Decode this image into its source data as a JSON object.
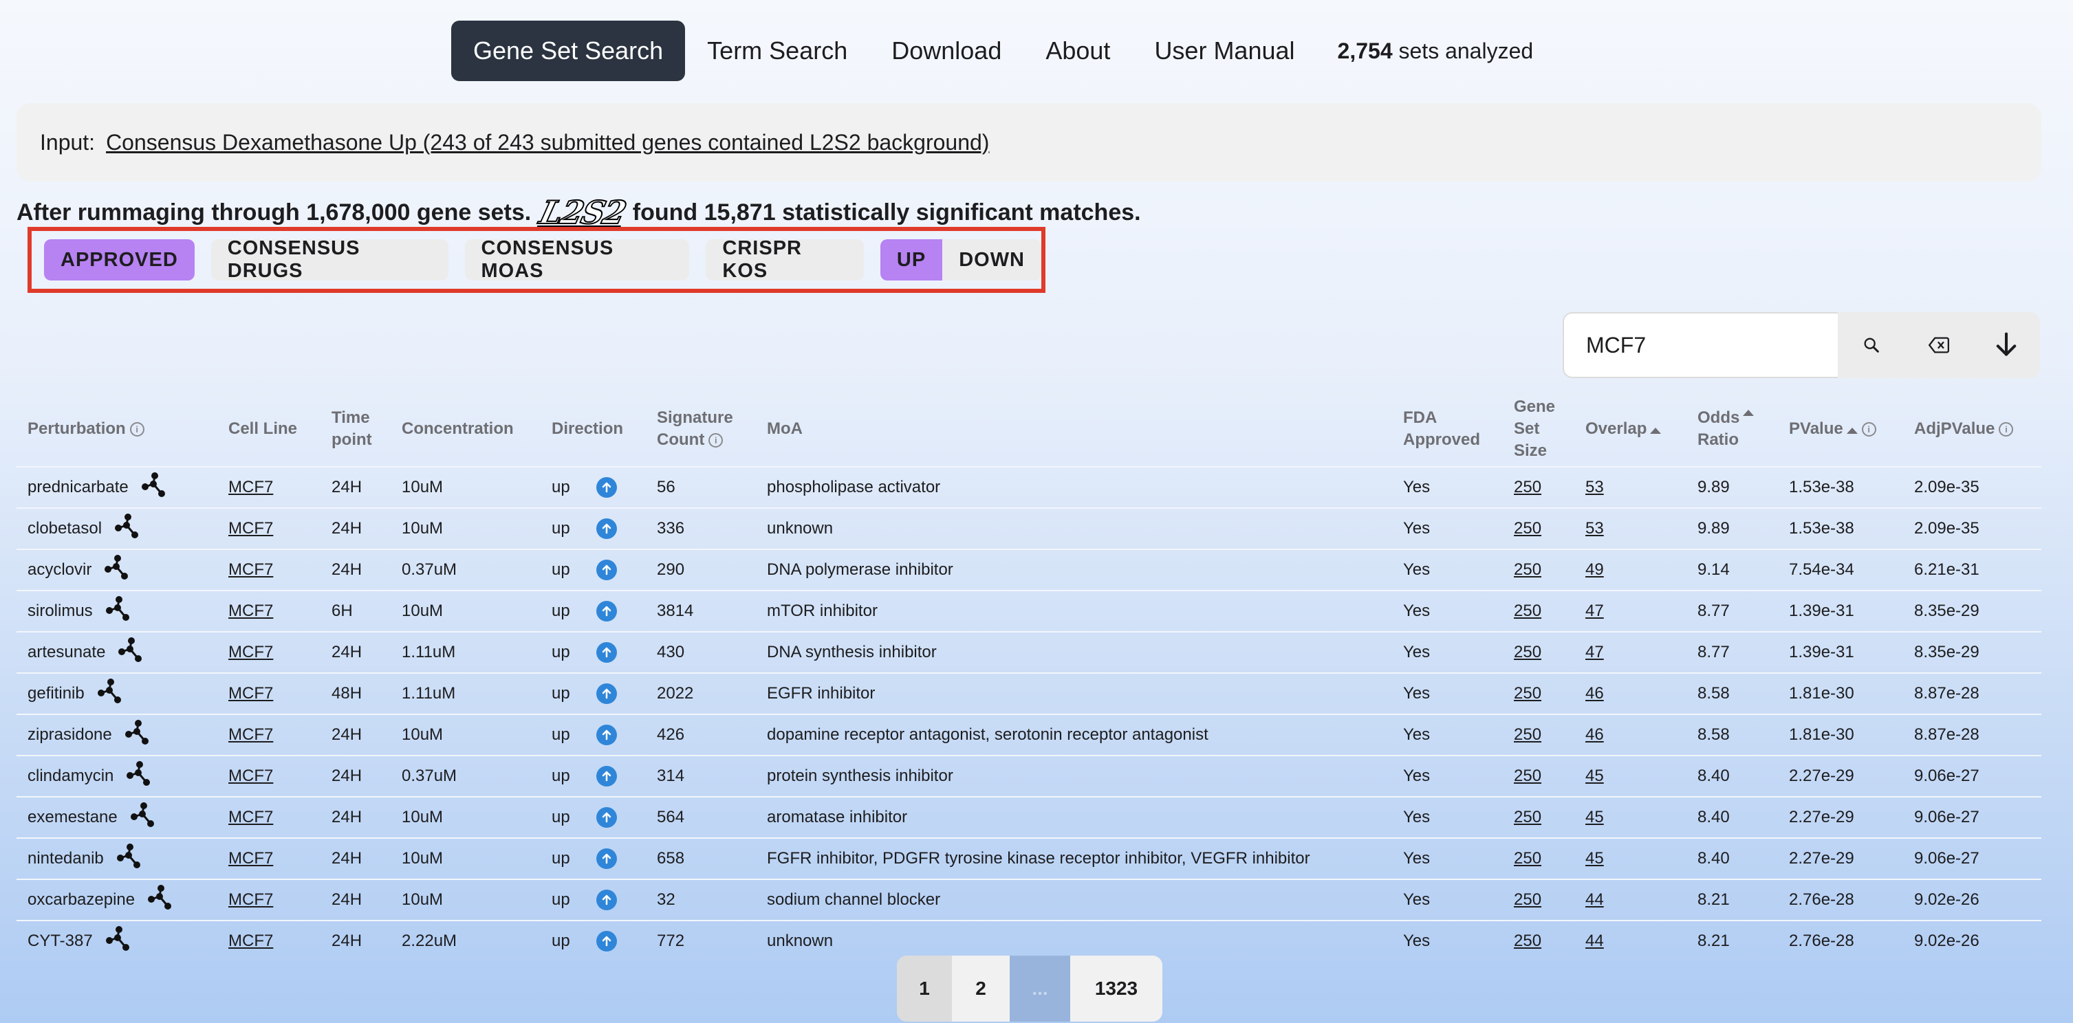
{
  "nav": {
    "items": [
      "Gene Set Search",
      "Term Search",
      "Download",
      "About",
      "User Manual"
    ],
    "stat_count": "2,754",
    "stat_text": "sets analyzed"
  },
  "input": {
    "label": "Input:",
    "link": "Consensus Dexamethasone Up (243 of 243 submitted genes contained L2S2 background)"
  },
  "summary": {
    "before": "After rummaging through 1,678,000 gene sets.",
    "logo": "L2S2",
    "after": "found 15,871 statistically significant matches."
  },
  "filters": {
    "approved": "APPROVED",
    "consensus_drugs": "CONSENSUS DRUGS",
    "consensus_moas": "CONSENSUS MOAS",
    "crispr_kos": "CRISPR KOS",
    "up": "UP",
    "down": "DOWN",
    "active_color": "#b782f2"
  },
  "search": {
    "value": "MCF7",
    "icons": [
      "search-icon",
      "clear-icon",
      "download-icon"
    ]
  },
  "table": {
    "headers": {
      "perturbation": "Perturbation",
      "cell_line": "Cell Line",
      "time_point": [
        "Time",
        "point"
      ],
      "concentration": "Concentration",
      "direction": "Direction",
      "signature_count": [
        "Signature",
        "Count"
      ],
      "moa": "MoA",
      "fda": [
        "FDA",
        "Approved"
      ],
      "gene_set_size": [
        "Gene",
        "Set",
        "Size"
      ],
      "overlap": "Overlap",
      "odds_ratio": [
        "Odds",
        "Ratio"
      ],
      "pvalue": "PValue",
      "adjpvalue": "AdjPValue"
    },
    "rows": [
      {
        "pert": "prednicarbate",
        "cell": "MCF7",
        "time": "24H",
        "conc": "10uM",
        "dir": "up",
        "sig": "56",
        "moa": "phospholipase activator",
        "fda": "Yes",
        "size": "250",
        "overlap": "53",
        "odds": "9.89",
        "p": "1.53e-38",
        "adjp": "2.09e-35"
      },
      {
        "pert": "clobetasol",
        "cell": "MCF7",
        "time": "24H",
        "conc": "10uM",
        "dir": "up",
        "sig": "336",
        "moa": "unknown",
        "fda": "Yes",
        "size": "250",
        "overlap": "53",
        "odds": "9.89",
        "p": "1.53e-38",
        "adjp": "2.09e-35"
      },
      {
        "pert": "acyclovir",
        "cell": "MCF7",
        "time": "24H",
        "conc": "0.37uM",
        "dir": "up",
        "sig": "290",
        "moa": "DNA polymerase inhibitor",
        "fda": "Yes",
        "size": "250",
        "overlap": "49",
        "odds": "9.14",
        "p": "7.54e-34",
        "adjp": "6.21e-31"
      },
      {
        "pert": "sirolimus",
        "cell": "MCF7",
        "time": "6H",
        "conc": "10uM",
        "dir": "up",
        "sig": "3814",
        "moa": "mTOR inhibitor",
        "fda": "Yes",
        "size": "250",
        "overlap": "47",
        "odds": "8.77",
        "p": "1.39e-31",
        "adjp": "8.35e-29"
      },
      {
        "pert": "artesunate",
        "cell": "MCF7",
        "time": "24H",
        "conc": "1.11uM",
        "dir": "up",
        "sig": "430",
        "moa": "DNA synthesis inhibitor",
        "fda": "Yes",
        "size": "250",
        "overlap": "47",
        "odds": "8.77",
        "p": "1.39e-31",
        "adjp": "8.35e-29"
      },
      {
        "pert": "gefitinib",
        "cell": "MCF7",
        "time": "48H",
        "conc": "1.11uM",
        "dir": "up",
        "sig": "2022",
        "moa": "EGFR inhibitor",
        "fda": "Yes",
        "size": "250",
        "overlap": "46",
        "odds": "8.58",
        "p": "1.81e-30",
        "adjp": "8.87e-28"
      },
      {
        "pert": "ziprasidone",
        "cell": "MCF7",
        "time": "24H",
        "conc": "10uM",
        "dir": "up",
        "sig": "426",
        "moa": "dopamine receptor antagonist, serotonin receptor antagonist",
        "fda": "Yes",
        "size": "250",
        "overlap": "46",
        "odds": "8.58",
        "p": "1.81e-30",
        "adjp": "8.87e-28"
      },
      {
        "pert": "clindamycin",
        "cell": "MCF7",
        "time": "24H",
        "conc": "0.37uM",
        "dir": "up",
        "sig": "314",
        "moa": "protein synthesis inhibitor",
        "fda": "Yes",
        "size": "250",
        "overlap": "45",
        "odds": "8.40",
        "p": "2.27e-29",
        "adjp": "9.06e-27"
      },
      {
        "pert": "exemestane",
        "cell": "MCF7",
        "time": "24H",
        "conc": "10uM",
        "dir": "up",
        "sig": "564",
        "moa": "aromatase inhibitor",
        "fda": "Yes",
        "size": "250",
        "overlap": "45",
        "odds": "8.40",
        "p": "2.27e-29",
        "adjp": "9.06e-27"
      },
      {
        "pert": "nintedanib",
        "cell": "MCF7",
        "time": "24H",
        "conc": "10uM",
        "dir": "up",
        "sig": "658",
        "moa": "FGFR inhibitor, PDGFR tyrosine kinase receptor inhibitor, VEGFR inhibitor",
        "fda": "Yes",
        "size": "250",
        "overlap": "45",
        "odds": "8.40",
        "p": "2.27e-29",
        "adjp": "9.06e-27"
      },
      {
        "pert": "oxcarbazepine",
        "cell": "MCF7",
        "time": "24H",
        "conc": "10uM",
        "dir": "up",
        "sig": "32",
        "moa": "sodium channel blocker",
        "fda": "Yes",
        "size": "250",
        "overlap": "44",
        "odds": "8.21",
        "p": "2.76e-28",
        "adjp": "9.02e-26"
      },
      {
        "pert": "CYT-387",
        "cell": "MCF7",
        "time": "24H",
        "conc": "2.22uM",
        "dir": "up",
        "sig": "772",
        "moa": "unknown",
        "fda": "Yes",
        "size": "250",
        "overlap": "44",
        "odds": "8.21",
        "p": "2.76e-28",
        "adjp": "9.02e-26"
      }
    ]
  },
  "pagination": {
    "pages": [
      "1",
      "2",
      "...",
      "1323"
    ],
    "current": "1"
  }
}
